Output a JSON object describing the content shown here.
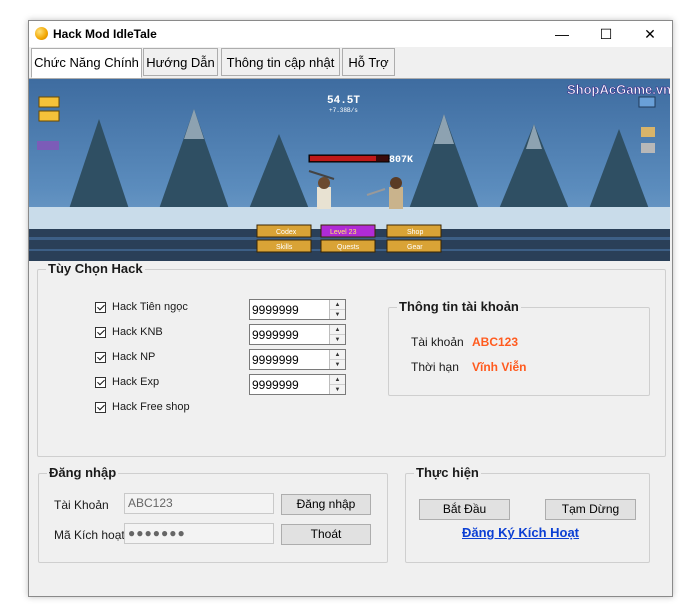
{
  "window": {
    "title": "Hack Mod IdleTale",
    "minimize_glyph": "—",
    "maximize_glyph": "☐",
    "close_glyph": "✕"
  },
  "tabs": [
    {
      "label": "Chức Năng Chính",
      "active": true
    },
    {
      "label": "Hướng Dẫn",
      "active": false
    },
    {
      "label": "Thông tin cập nhật",
      "active": false
    },
    {
      "label": "Hỗ Trợ",
      "active": false
    }
  ],
  "banner": {
    "watermark": "ShopAcGame.vn",
    "gold": "54.5T",
    "gold_rate": "+7.38B/s",
    "enemy_hp": "807K",
    "menu": [
      "Codex",
      "Level 23",
      "Shop",
      "Skills",
      "Quests",
      "Gear"
    ]
  },
  "hack_options": {
    "title": "Tùy Chọn Hack",
    "items": [
      {
        "label": "Hack Tiên ngọc",
        "checked": true,
        "value": "9999999"
      },
      {
        "label": "Hack KNB",
        "checked": true,
        "value": "9999999"
      },
      {
        "label": "Hack NP",
        "checked": true,
        "value": "9999999"
      },
      {
        "label": "Hack Exp",
        "checked": true,
        "value": "9999999"
      },
      {
        "label": "Hack Free shop",
        "checked": true
      }
    ]
  },
  "account_info": {
    "title": "Thông tin tài khoản",
    "account_label": "Tài khoản",
    "account_value": "ABC123",
    "term_label": "Thời hạn",
    "term_value": "Vĩnh Viễn"
  },
  "login": {
    "title": "Đăng nhập",
    "account_label": "Tài Khoản",
    "account_value": "ABC123",
    "code_label": "Mã Kích hoạt",
    "code_value": "●●●●●●●",
    "login_button": "Đăng nhập",
    "exit_button": "Thoát"
  },
  "execute": {
    "title": "Thực hiện",
    "start_button": "Bắt Đầu",
    "pause_button": "Tạm Dừng",
    "register_link": "Đăng Ký Kích Hoạt"
  },
  "colors": {
    "accent_orange": "#ff5b1f",
    "link_blue": "#0b3fd4",
    "window_bg": "#f0f0f0"
  }
}
